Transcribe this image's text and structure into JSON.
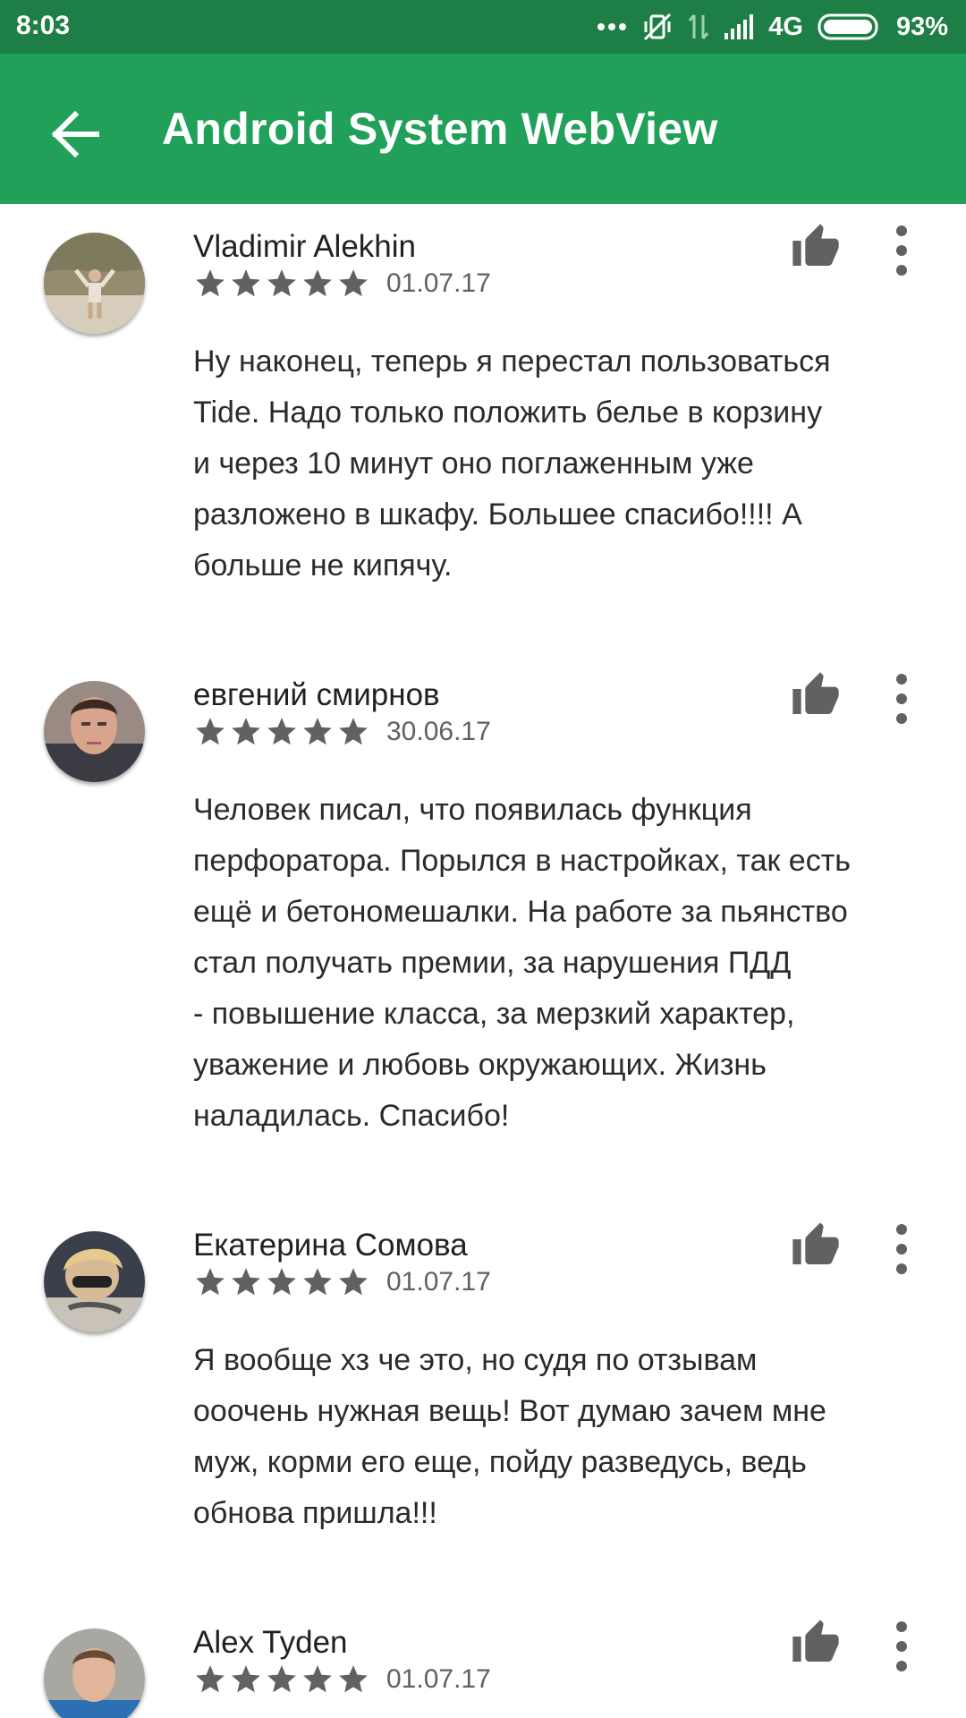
{
  "status_bar": {
    "time": "8:03",
    "network": "4G",
    "battery": "93%",
    "icons": [
      "more-dots-icon",
      "vibrate-off-icon",
      "data-arrows-icon",
      "signal-icon",
      "battery-icon"
    ]
  },
  "app_bar": {
    "title": "Android System WebView",
    "back_icon": "arrow-back-icon",
    "color": "#21a05a"
  },
  "reviews": [
    {
      "name": "Vladimir Alekhin",
      "rating": 5,
      "date": "01.07.17",
      "text": "Ну наконец, теперь я перестал пользоваться\nTide. Надо только положить белье в корзину\nи через 10 минут оно поглаженным уже\nразложено в шкафу. Большее спасибо!!!! А\nбольше не кипячу."
    },
    {
      "name": "евгений смирнов",
      "rating": 5,
      "date": "30.06.17",
      "text": "Человек писал, что появилась функция\nперфоратора. Порылся в настройках, так есть\nещё и бетономешалки. На работе за пьянство\nстал получать премии, за нарушения ПДД\n- повышение класса, за мерзкий характер,\nуважение и любовь окружающих. Жизнь\nналадилась. Спасибо!"
    },
    {
      "name": "Екатерина Сомова",
      "rating": 5,
      "date": "01.07.17",
      "text": "Я вообще хз че это, но судя по отзывам\nооочень нужная вещь! Вот думаю зачем мне\nмуж, корми его еще, пойду разведусь, ведь\nобнова пришла!!!"
    },
    {
      "name": "Alex Tyden",
      "rating": 5,
      "date": "01.07.17",
      "text": ""
    }
  ],
  "colors": {
    "status_bar": "#1d7f45",
    "accent": "#21a05a",
    "star": "#616161",
    "icon": "#616161"
  }
}
